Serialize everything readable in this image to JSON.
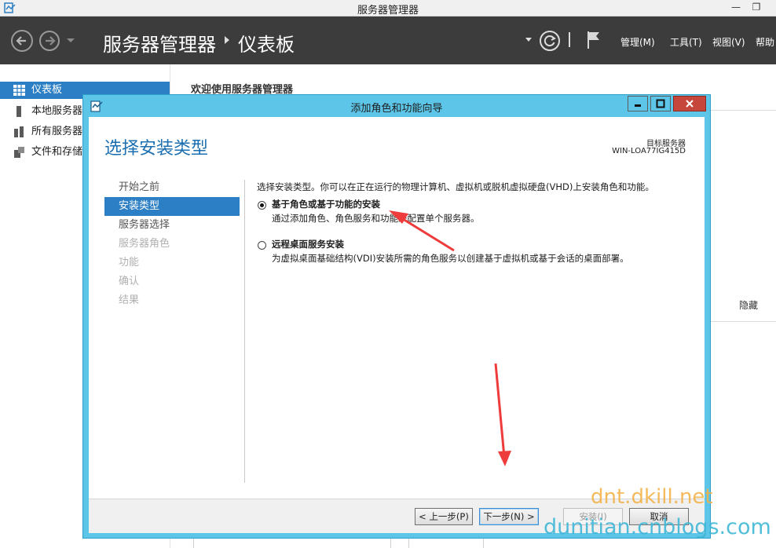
{
  "window": {
    "title": "服务器管理器",
    "minimize_glyph": "—",
    "restore_glyph": "❐"
  },
  "toolbar": {
    "breadcrumb_root": "服务器管理器",
    "breadcrumb_current": "仪表板",
    "menus": [
      "管理(M)",
      "工具(T)",
      "视图(V)",
      "帮助"
    ]
  },
  "sidebar": {
    "items": [
      {
        "label": "仪表板",
        "icon": "dashboard-grid-icon",
        "active": true
      },
      {
        "label": "本地服务器",
        "icon": "server-icon",
        "active": false
      },
      {
        "label": "所有服务器",
        "icon": "servers-icon",
        "active": false
      },
      {
        "label": "文件和存储服务",
        "icon": "file-storage-icon",
        "active": false
      }
    ]
  },
  "background": {
    "welcome": "欢迎使用服务器管理器",
    "hide_link": "隐藏"
  },
  "dialog": {
    "title": "添加角色和功能向导",
    "heading": "选择安装类型",
    "destination_label": "目标服务器",
    "destination_name": "WIN-LOA77IG415D",
    "steps": [
      {
        "label": "开始之前",
        "state": "enabled"
      },
      {
        "label": "安装类型",
        "state": "active"
      },
      {
        "label": "服务器选择",
        "state": "enabled"
      },
      {
        "label": "服务器角色",
        "state": "disabled"
      },
      {
        "label": "功能",
        "state": "disabled"
      },
      {
        "label": "确认",
        "state": "disabled"
      },
      {
        "label": "结果",
        "state": "disabled"
      }
    ],
    "intro": "选择安装类型。你可以在正在运行的物理计算机、虚拟机或脱机虚拟硬盘(VHD)上安装角色和功能。",
    "options": [
      {
        "title": "基于角色或基于功能的安装",
        "description": "通过添加角色、角色服务和功能来配置单个服务器。",
        "selected": true
      },
      {
        "title": "远程桌面服务安装",
        "description": "为虚拟桌面基础结构(VDI)安装所需的角色服务以创建基于虚拟机或基于会话的桌面部署。",
        "selected": false
      }
    ],
    "buttons": {
      "previous": "< 上一步(P)",
      "next": "下一步(N) >",
      "install": "安装(I)",
      "cancel": "取消"
    }
  },
  "watermark": {
    "line1": "dnt.dkill.net",
    "line2": "dunitian.cnblogs.com"
  },
  "colors": {
    "accent_blue": "#2c7fc4",
    "dialog_frame": "#5cc5e8",
    "toolbar_bg": "#3c3c3c",
    "annotation_arrow": "#ee3b3b",
    "watermark_orange": "#f3b34a",
    "watermark_blue": "#3fb7d7"
  }
}
